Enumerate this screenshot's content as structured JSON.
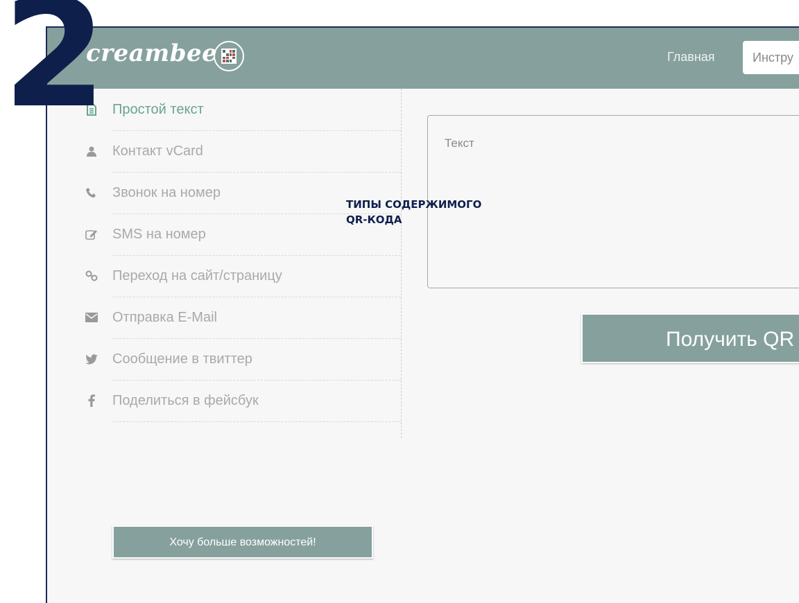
{
  "step_number": "2",
  "brand": {
    "name": "creambee",
    "badge_icon": "qr-code-icon"
  },
  "nav": {
    "home": "Главная",
    "tools": "Инстру"
  },
  "sidebar": {
    "items": [
      {
        "label": "Простой текст",
        "icon": "document-icon",
        "active": true
      },
      {
        "label": "Контакт vCard",
        "icon": "user-icon",
        "active": false
      },
      {
        "label": "Звонок на номер",
        "icon": "phone-icon",
        "active": false
      },
      {
        "label": "SMS на номер",
        "icon": "edit-icon",
        "active": false
      },
      {
        "label": "Переход на сайт/страницу",
        "icon": "link-icon",
        "active": false
      },
      {
        "label": "Отправка E-Mail",
        "icon": "envelope-icon",
        "active": false
      },
      {
        "label": "Сообщение в твиттер",
        "icon": "twitter-icon",
        "active": false
      },
      {
        "label": "Поделиться в фейсбук",
        "icon": "facebook-icon",
        "active": false
      }
    ],
    "more_button": "Хочу больше возможностей!"
  },
  "main": {
    "text_placeholder": "Текст",
    "get_qr_label": "Получить QR"
  },
  "callout": {
    "line1": "ТИПЫ СОДЕРЖИМОГО",
    "line2": "QR-КОДА"
  },
  "colors": {
    "accent": "#86a19d",
    "active": "#52a07e",
    "annotation": "#0e1f4c"
  }
}
